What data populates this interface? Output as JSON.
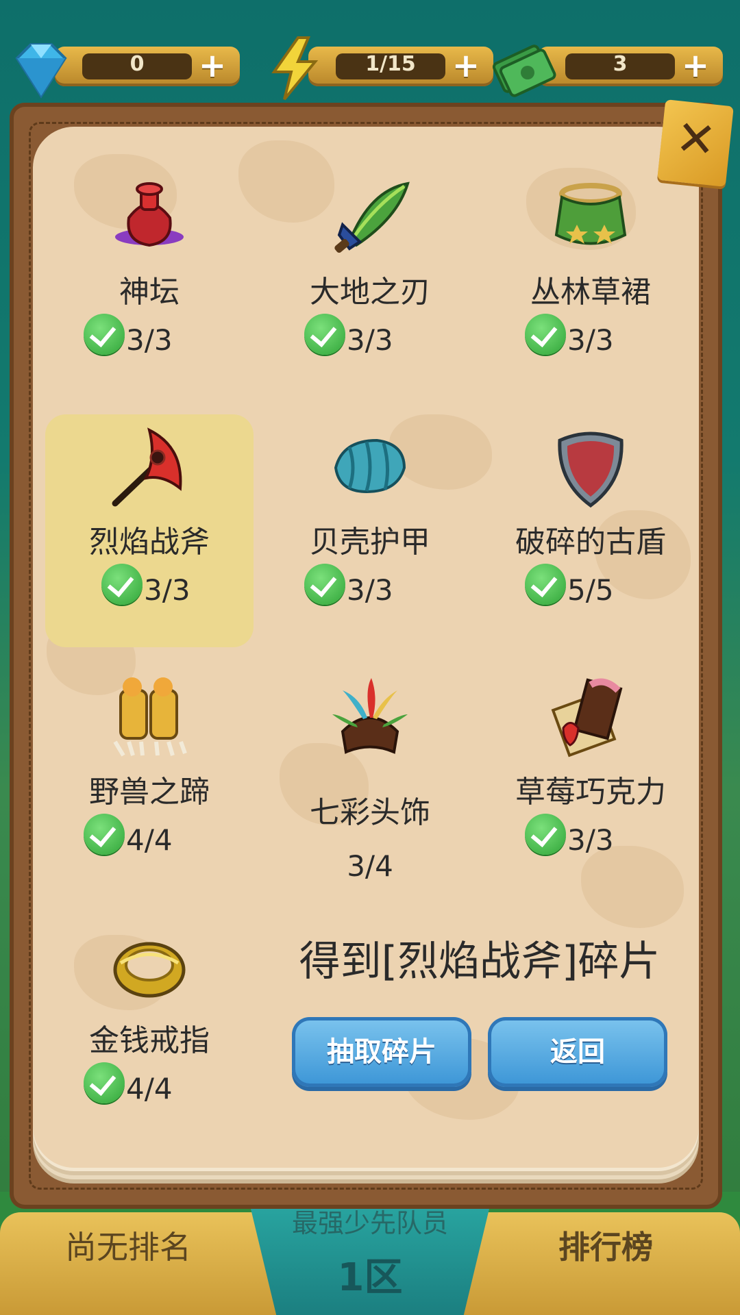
{
  "resources": {
    "gems": {
      "value": "0",
      "icon": "gem-icon"
    },
    "energy": {
      "value": "1/15",
      "icon": "lightning-icon"
    },
    "cash": {
      "value": "3",
      "icon": "cash-icon"
    }
  },
  "items": [
    {
      "name": "神坛",
      "count": "3/3",
      "complete": true,
      "icon": "altar-icon"
    },
    {
      "name": "大地之刃",
      "count": "3/3",
      "complete": true,
      "icon": "leaf-blade-icon"
    },
    {
      "name": "丛林草裙",
      "count": "3/3",
      "complete": true,
      "icon": "grass-skirt-icon"
    },
    {
      "name": "烈焰战斧",
      "count": "3/3",
      "complete": true,
      "selected": true,
      "icon": "flame-axe-icon"
    },
    {
      "name": "贝壳护甲",
      "count": "3/3",
      "complete": true,
      "icon": "shell-armor-icon"
    },
    {
      "name": "破碎的古盾",
      "count": "5/5",
      "complete": true,
      "icon": "shield-icon"
    },
    {
      "name": "野兽之蹄",
      "count": "4/4",
      "complete": true,
      "icon": "beast-hoof-icon"
    },
    {
      "name": "七彩头饰",
      "count": "3/4",
      "complete": false,
      "icon": "feather-headdress-icon"
    },
    {
      "name": "草莓巧克力",
      "count": "3/3",
      "complete": true,
      "icon": "strawberry-chocolate-icon"
    },
    {
      "name": "金钱戒指",
      "count": "4/4",
      "complete": true,
      "icon": "gold-ring-icon"
    }
  ],
  "message": "得到[烈焰战斧]碎片",
  "buttons": {
    "draw": "抽取碎片",
    "back": "返回"
  },
  "bottom": {
    "left": "尚无排名",
    "center_sub": "最强少先队员",
    "zone": "1区",
    "right": "排行榜"
  }
}
